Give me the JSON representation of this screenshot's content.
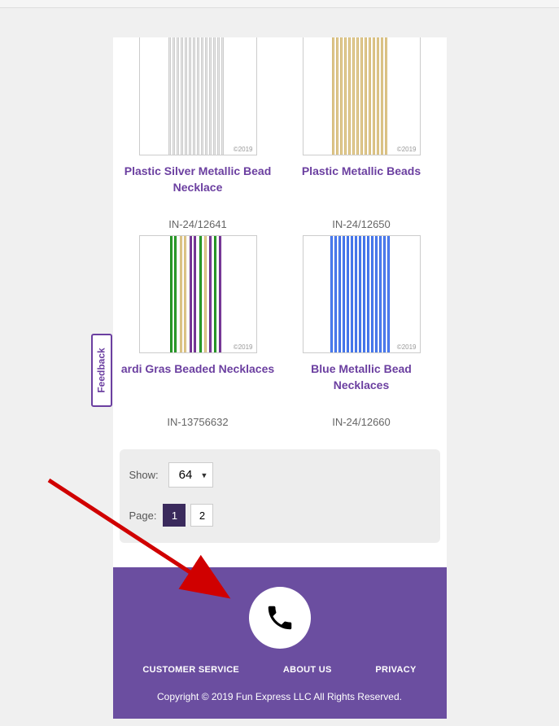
{
  "products": [
    {
      "title": "Plastic Silver Metallic Bead Necklace",
      "sku": "IN-24/12641",
      "image_type": "silver"
    },
    {
      "title": "Plastic Metallic Beads",
      "sku": "IN-24/12650",
      "image_type": "gold"
    },
    {
      "title": "ardi Gras Beaded Necklaces",
      "sku": "IN-13756632",
      "image_type": "mardigras"
    },
    {
      "title": "Blue Metallic Bead Necklaces",
      "sku": "IN-24/12660",
      "image_type": "blue"
    }
  ],
  "pagination": {
    "show_label": "Show:",
    "show_value": "64",
    "page_label": "Page:",
    "current_page": "1",
    "pages": [
      "1",
      "2"
    ]
  },
  "footer": {
    "links": [
      "CUSTOMER SERVICE",
      "ABOUT US",
      "PRIVACY"
    ],
    "copyright": "Copyright © 2019 Fun Express LLC All Rights Reserved."
  },
  "feedback_label": "Feedback",
  "image_copyright": "©2019"
}
